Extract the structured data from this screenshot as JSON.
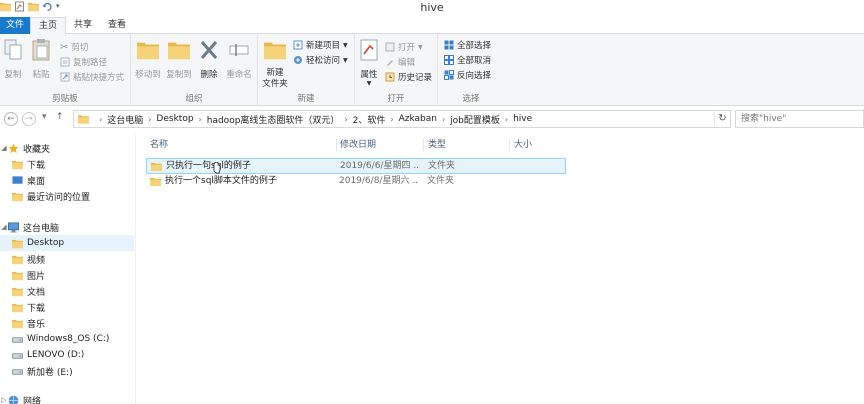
{
  "window": {
    "title": "hive"
  },
  "ribbon_tabs": [
    {
      "label": "文件"
    },
    {
      "label": "主页"
    },
    {
      "label": "共享"
    },
    {
      "label": "查看"
    }
  ],
  "ribbon": {
    "clipboard": {
      "label": "剪贴板",
      "copy": "复制",
      "paste": "粘贴",
      "cut": "剪切",
      "copy_path": "复制路径",
      "paste_shortcut": "粘贴快捷方式"
    },
    "organize": {
      "label": "组织",
      "move_to": "移动到",
      "copy_to": "复制到",
      "delete": "删除",
      "rename": "重命名"
    },
    "new": {
      "label": "新建",
      "new_folder_line1": "新建",
      "new_folder_line2": "文件夹",
      "new_item": "新建项目",
      "easy_access": "轻松访问"
    },
    "open": {
      "label": "打开",
      "properties": "属性",
      "open": "打开",
      "edit": "编辑",
      "history": "历史记录"
    },
    "select": {
      "label": "选择",
      "select_all": "全部选择",
      "select_none": "全部取消",
      "invert": "反向选择"
    }
  },
  "address": {
    "segments": [
      "这台电脑",
      "Desktop",
      "hadoop离线生态圈软件（双元）",
      "2、软件",
      "Azkaban",
      "job配置模板",
      "hive"
    ],
    "search_placeholder": "搜索\"hive\""
  },
  "nav": {
    "favorites": {
      "label": "收藏夹",
      "items": [
        "下载",
        "桌面",
        "最近访问的位置"
      ]
    },
    "this_pc": {
      "label": "这台电脑",
      "items": [
        "Desktop",
        "视频",
        "图片",
        "文档",
        "下载",
        "音乐",
        "Windows8_OS (C:)",
        "LENOVO (D:)",
        "新加卷 (E:)"
      ]
    },
    "network": {
      "label": "网络"
    }
  },
  "columns": {
    "name": "名称",
    "date": "修改日期",
    "type": "类型",
    "size": "大小"
  },
  "files": [
    {
      "name": "只执行一句sql的例子",
      "date": "2019/6/6/星期四 ...",
      "type": "文件夹",
      "selected": true
    },
    {
      "name": "执行一个sql脚本文件的例子",
      "date": "2019/6/8/星期六 ...",
      "type": "文件夹",
      "selected": false
    }
  ],
  "colors": {
    "file_tab": "#1979ca",
    "selection": "#e5f3fb",
    "folder": "#e8b84a"
  }
}
